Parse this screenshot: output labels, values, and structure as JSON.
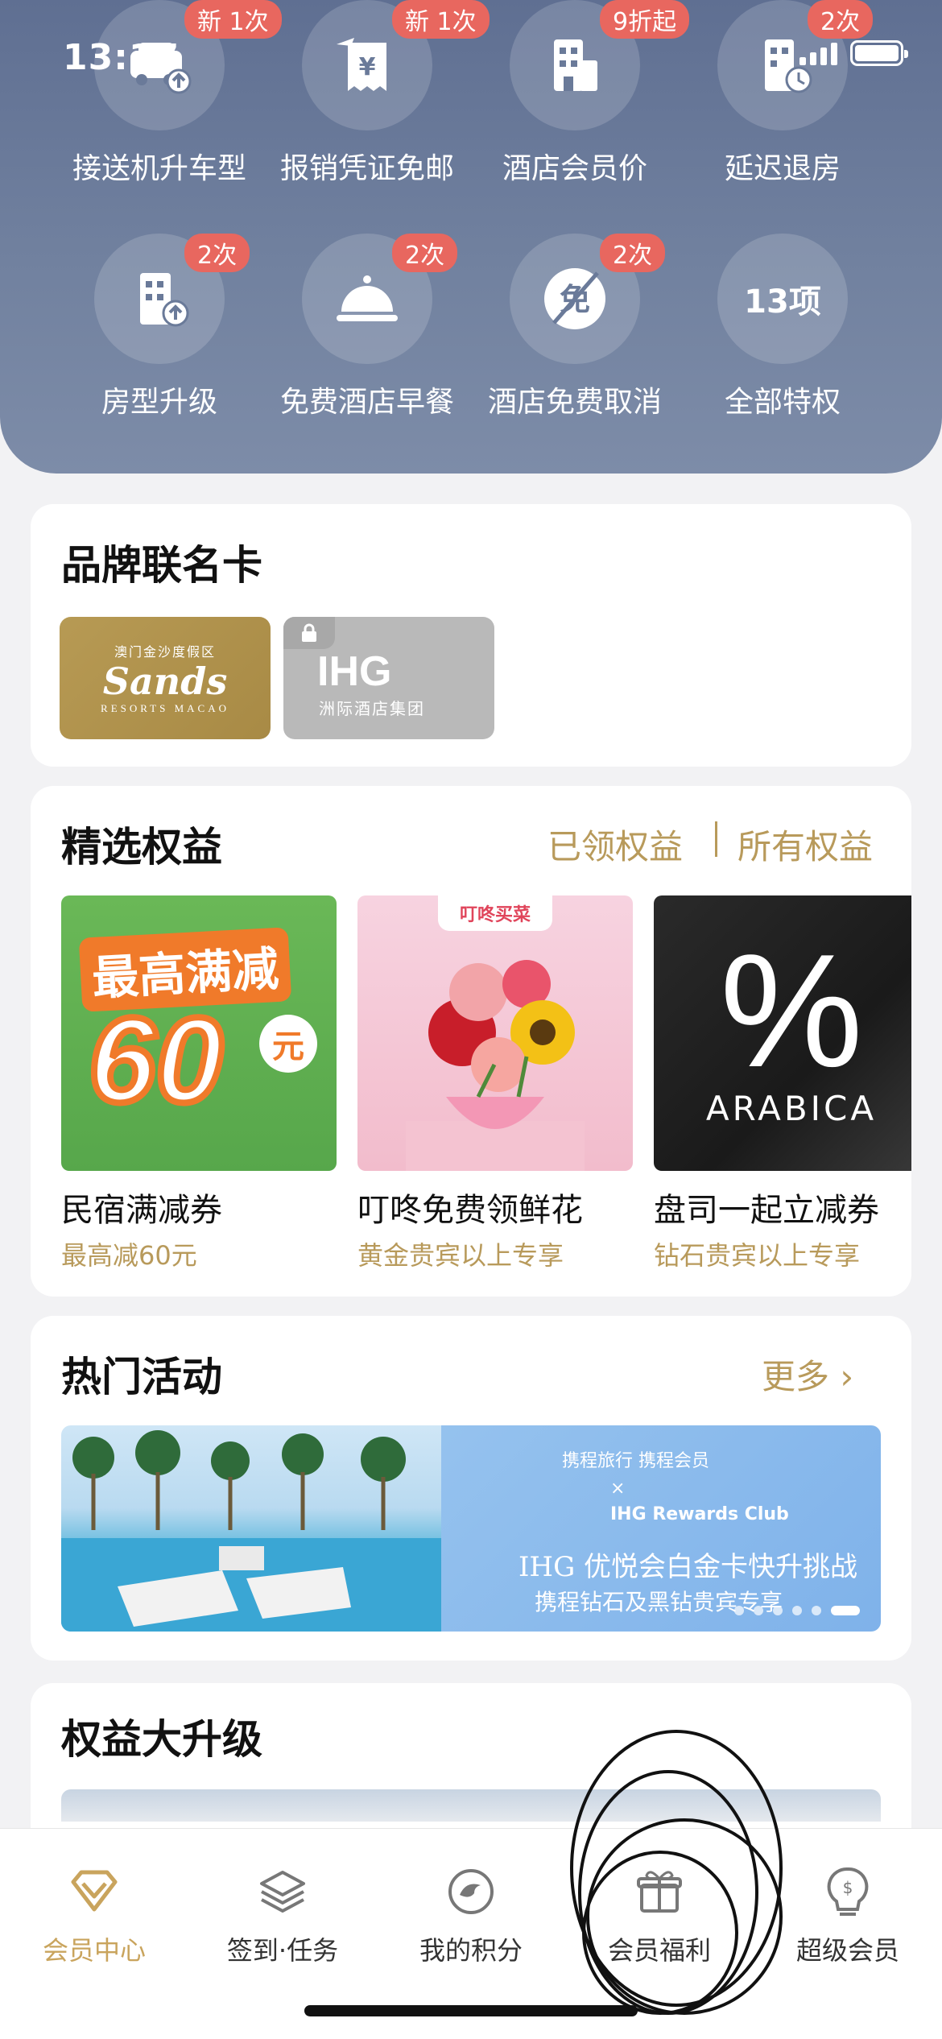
{
  "status": {
    "time": "13:17"
  },
  "perks": [
    {
      "label": "接送机升车型",
      "badge": "新 1次",
      "icon": "car-upgrade-icon"
    },
    {
      "label": "报销凭证免邮",
      "badge": "新 1次",
      "icon": "receipt-icon"
    },
    {
      "label": "酒店会员价",
      "badge": "9折起",
      "icon": "hotel-icon"
    },
    {
      "label": "延迟退房",
      "badge": "2次",
      "icon": "late-checkout-icon"
    },
    {
      "label": "房型升级",
      "badge": "2次",
      "icon": "room-upgrade-icon"
    },
    {
      "label": "免费酒店早餐",
      "badge": "2次",
      "icon": "breakfast-cloche-icon"
    },
    {
      "label": "酒店免费取消",
      "badge": "2次",
      "icon": "free-cancel-icon"
    },
    {
      "label": "全部特权",
      "count": "13项"
    }
  ],
  "brand_cards": {
    "title": "品牌联名卡",
    "sands": {
      "cn": "澳门金沙度假区",
      "name": "Sands",
      "sub": "RESORTS MACAO"
    },
    "ihg": {
      "name": "IHG",
      "sub": "洲际酒店集团"
    }
  },
  "benefits": {
    "title": "精选权益",
    "claimed_link": "已领权益",
    "all_link": "所有权益",
    "items": [
      {
        "name": "民宿满减券",
        "sub": "最高减60元",
        "art_title": "最高满减",
        "art_value": "60",
        "art_unit": "元"
      },
      {
        "name": "叮咚免费领鲜花",
        "sub": "黄金贵宾以上专享",
        "art_tag": "叮咚买菜"
      },
      {
        "name": "盘司一起立减券",
        "sub": "钻石贵宾以上专享",
        "art_symbol": "%",
        "art_word": "ARABICA"
      }
    ]
  },
  "activities": {
    "title": "热门活动",
    "more": "更多",
    "banner": {
      "line1": "携程旅行  携程会员",
      "line2": "×",
      "line3": "IHG Rewards Club",
      "line4": "IHG 优悦会白金卡快升挑战",
      "line5": "携程钻石及黑钻贵宾专享"
    }
  },
  "upgrade": {
    "title": "权益大升级"
  },
  "tabs": [
    {
      "label": "会员中心",
      "icon": "member-diamond-icon",
      "active": true
    },
    {
      "label": "签到·任务",
      "icon": "layers-icon",
      "active": false
    },
    {
      "label": "我的积分",
      "icon": "points-icon",
      "active": false
    },
    {
      "label": "会员福利",
      "icon": "gift-icon",
      "active": false
    },
    {
      "label": "超级会员",
      "icon": "super-member-icon",
      "active": false
    }
  ],
  "colors": {
    "accent_gold": "#b89a5b",
    "badge_red": "#e8675f",
    "hero_blue": "#6a7a99"
  }
}
